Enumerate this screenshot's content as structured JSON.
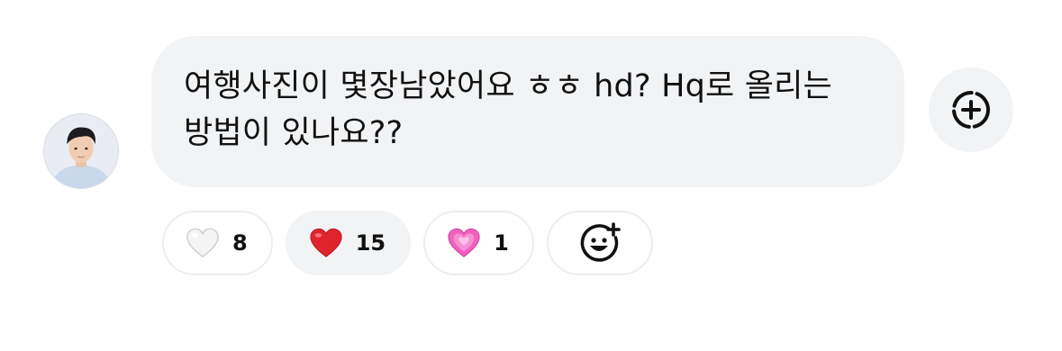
{
  "comment": {
    "text": "여행사진이 몇장남았어요 ㅎㅎ hd? Hq로 올리는 방법이 있나요??"
  },
  "reactions": [
    {
      "emoji": "white-heart",
      "count": "8",
      "selected": false
    },
    {
      "emoji": "red-heart",
      "count": "15",
      "selected": true
    },
    {
      "emoji": "growing-heart",
      "count": "1",
      "selected": false
    }
  ],
  "icons": {
    "add_reaction": "dashed-circle-plus-icon",
    "add_emoji": "smiley-plus-icon"
  },
  "colors": {
    "bubble_bg": "#f2f3f5",
    "red_heart": "#e0242e",
    "pink_heart": "#f25fbf"
  }
}
